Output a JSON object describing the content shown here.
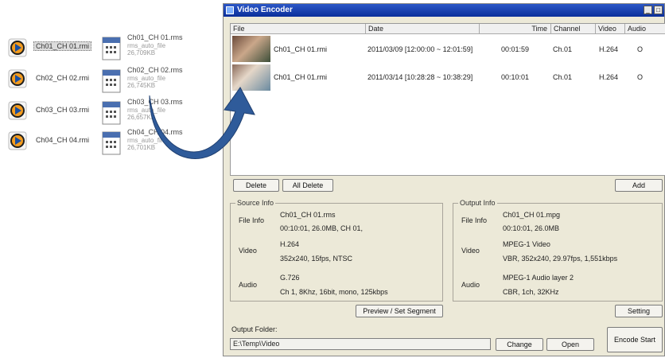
{
  "desktop": {
    "rmi_files": [
      {
        "name": "Ch01_CH 01.rmi"
      },
      {
        "name": "Ch02_CH 02.rmi"
      },
      {
        "name": "Ch03_CH 03.rmi"
      },
      {
        "name": "Ch04_CH 04.rmi"
      }
    ],
    "rms_files": [
      {
        "name": "Ch01_CH 01.rms",
        "type": "rms_auto_file",
        "size": "26,709KB"
      },
      {
        "name": "Ch02_CH 02.rms",
        "type": "rms_auto_file",
        "size": "26,745KB"
      },
      {
        "name": "Ch03_CH 03.rms",
        "type": "rms_auto_file",
        "size": "26,657KB"
      },
      {
        "name": "Ch04_CH 04.rms",
        "type": "rms_auto_file",
        "size": "26,701KB"
      }
    ]
  },
  "window": {
    "title": "Video Encoder",
    "controls": {
      "minimize": "_",
      "maximize": "□"
    }
  },
  "list": {
    "columns": [
      "File",
      "Date",
      "Time",
      "Channel",
      "Video",
      "Audio"
    ],
    "rows": [
      {
        "file": "Ch01_CH 01.rmi",
        "date": "2011/03/09 [12:00:00 ~ 12:01:59]",
        "time": "00:01:59",
        "channel": "Ch.01",
        "video": "H.264",
        "audio": "O"
      },
      {
        "file": "Ch01_CH 01.rmi",
        "date": "2011/03/14 [10:28:28 ~ 10:38:29]",
        "time": "00:10:01",
        "channel": "Ch.01",
        "video": "H.264",
        "audio": "O"
      }
    ]
  },
  "buttons": {
    "delete": "Delete",
    "all_delete": "All Delete",
    "add": "Add",
    "preview": "Preview / Set Segment",
    "setting": "Setting",
    "change": "Change",
    "open": "Open",
    "encode": "Encode Start"
  },
  "source": {
    "title": "Source Info",
    "file_label": "File Info",
    "file_line1": "Ch01_CH 01.rms",
    "file_line2": "00:10:01, 26.0MB, CH 01,",
    "video_label": "Video",
    "video_line1": "H.264",
    "video_line2": "352x240, 15fps, NTSC",
    "audio_label": "Audio",
    "audio_line1": "G.726",
    "audio_line2": "Ch 1, 8Khz, 16bit, mono, 125kbps"
  },
  "output": {
    "title": "Output Info",
    "file_label": "File Info",
    "file_line1": "Ch01_CH 01.mpg",
    "file_line2": "00:10:01, 26.0MB",
    "video_label": "Video",
    "video_line1": "MPEG-1 Video",
    "video_line2": "VBR, 352x240, 29.97fps, 1,551kbps",
    "audio_label": "Audio",
    "audio_line1": "MPEG-1 Audio layer 2",
    "audio_line2": "CBR, 1ch, 32KHz"
  },
  "folder": {
    "label": "Output Folder:",
    "value": "E:\\Temp\\Video"
  },
  "colors": {
    "arrow": "#2f5b9a",
    "titlebar": "#0a2e9a"
  }
}
